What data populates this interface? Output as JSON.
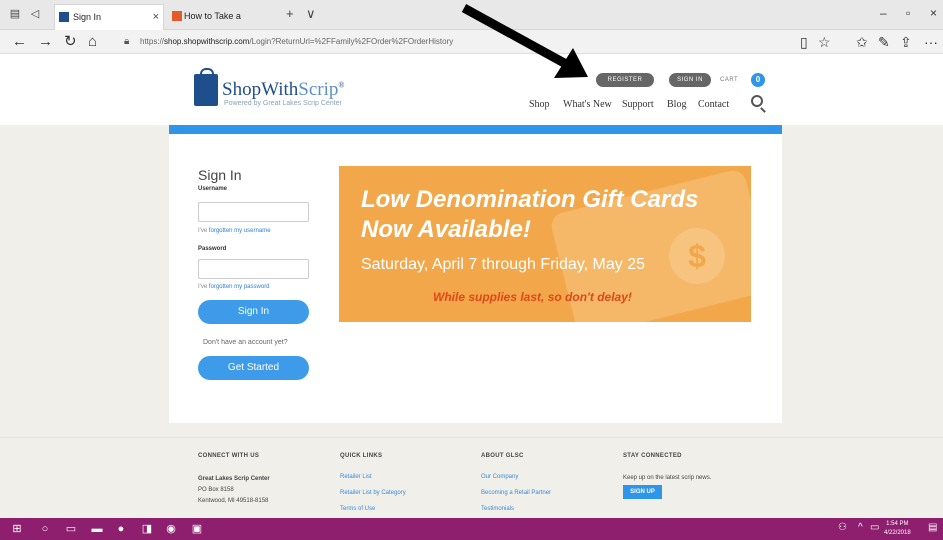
{
  "browser": {
    "tabs": [
      {
        "label": "Sign In",
        "active": true
      },
      {
        "label": "How to Take a Screenshot c",
        "active": false
      }
    ],
    "new_tab": "+",
    "tab_dropdown": "∨",
    "window_controls": {
      "minimize": "–",
      "maximize": "▫",
      "close": "×"
    },
    "nav": {
      "back": "←",
      "forward": "→",
      "refresh": "↻",
      "home": "⌂"
    },
    "address": {
      "prefix": "https://",
      "host": "shop.shopwithscrip.com",
      "path": "/Login?ReturnUrl=%2FFamily%2FOrder%2FOrderHistory"
    },
    "tools": {
      "reading": "▯",
      "favorite": "☆",
      "favorites_hub": "✩",
      "notes": "✎",
      "share": "⇪",
      "more": "···"
    }
  },
  "header": {
    "logo_main": "ShopWith",
    "logo_accent": "Scrip",
    "logo_reg": "®",
    "logo_sub": "Powered by Great Lakes Scrip Center",
    "register_label": "REGISTER",
    "signin_label": "SIGN IN",
    "cart_label": "CART",
    "cart_count": "0",
    "menu": [
      "Shop",
      "What's New",
      "Support",
      "Blog",
      "Contact"
    ]
  },
  "signin": {
    "title": "Sign In",
    "username_label": "Username",
    "forgot_username_prefix": "I've ",
    "forgot_username_link": "forgotten my username",
    "password_label": "Password",
    "forgot_password_prefix": "I've ",
    "forgot_password_link": "forgotten my password",
    "signin_button": "Sign In",
    "no_account": "Don't have an account yet?",
    "get_started_button": "Get Started"
  },
  "banner": {
    "line1": "Low Denomination Gift Cards",
    "line2": "Now Available!",
    "dates": "Saturday, April 7 through Friday, May 25",
    "supplies": "While supplies last, so don't delay!",
    "coin_symbol": "$"
  },
  "footer": {
    "connect": {
      "heading": "CONNECT WITH US",
      "lines": [
        "Great Lakes Scrip Center",
        "PO Box 8158",
        "Kentwood, MI  49518-8158"
      ]
    },
    "quick_links": {
      "heading": "QUICK LINKS",
      "links": [
        "Retailer List",
        "Retailer List by Category",
        "Terms of Use"
      ]
    },
    "about": {
      "heading": "ABOUT GLSC",
      "links": [
        "Our Company",
        "Becoming a Retail Partner",
        "Testimonials"
      ]
    },
    "stay": {
      "heading": "STAY CONNECTED",
      "text": "Keep up on the latest scrip news.",
      "button": "SIGN UP"
    }
  },
  "taskbar": {
    "time": "1:54 PM",
    "date": "4/22/2018"
  },
  "colors": {
    "accent_blue": "#2e95e8",
    "banner_orange": "#f2a84a",
    "banner_red": "#e04818",
    "logo_navy": "#1f4e8c",
    "taskbar": "#8e1f6f"
  }
}
